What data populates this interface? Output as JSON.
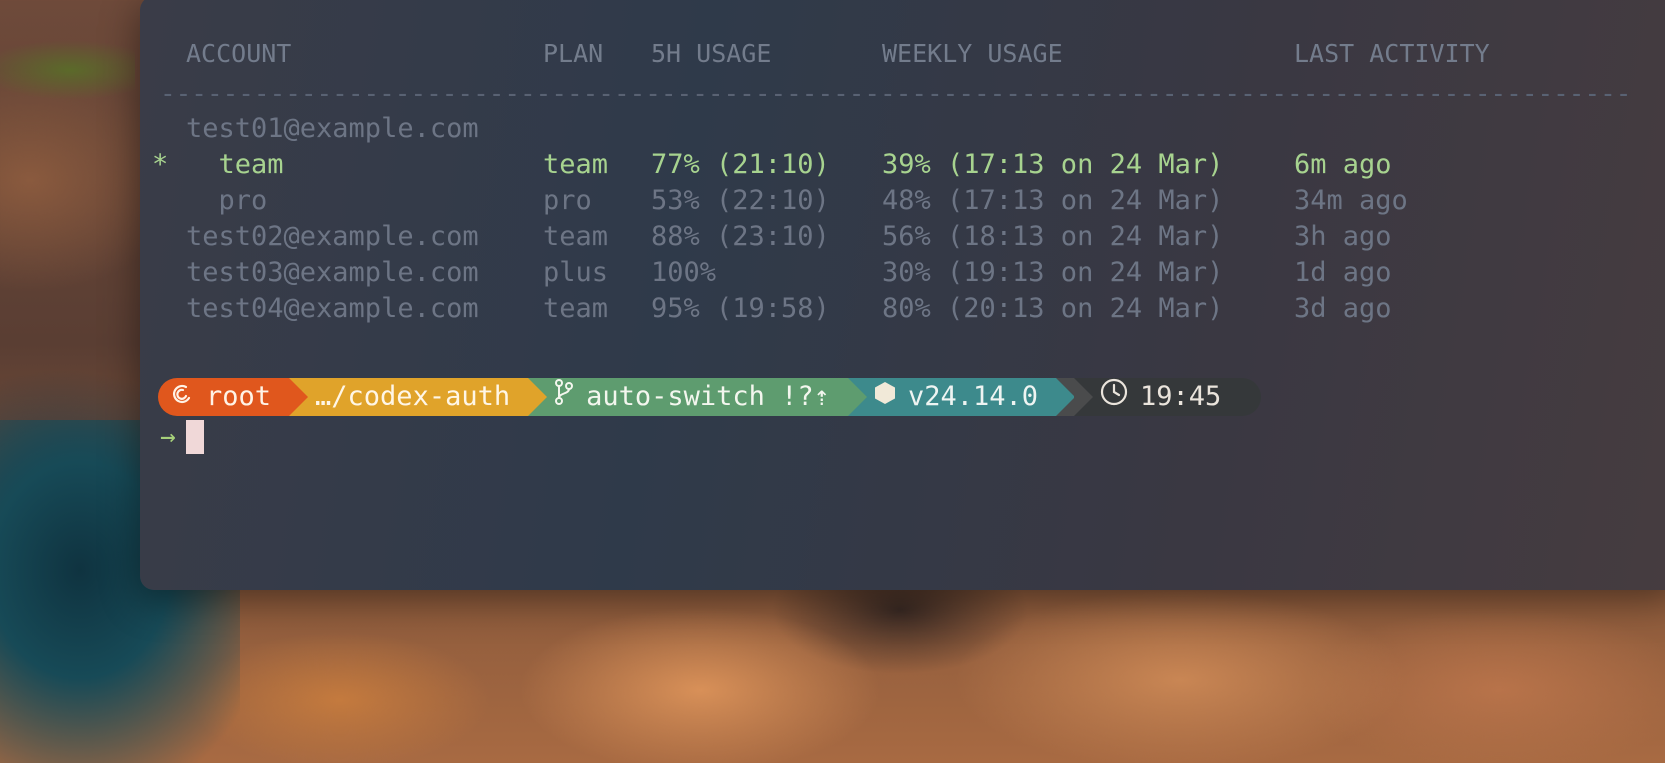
{
  "table": {
    "headers": {
      "account": "ACCOUNT",
      "plan": "PLAN",
      "five_hour": "5H USAGE",
      "weekly": "WEEKLY USAGE",
      "last_activity": "LAST ACTIVITY"
    },
    "divider": "------------------------------------------------------------------------------------------------------------",
    "rows": [
      {
        "marker": "",
        "account": "test01@example.com",
        "plan": "",
        "five_hour": "",
        "weekly": "",
        "last_activity": ""
      },
      {
        "marker": "*",
        "account": "  team",
        "plan": "team",
        "five_hour": "77% (21:10)",
        "weekly": "39% (17:13 on 24 Mar)",
        "last_activity": "6m ago"
      },
      {
        "marker": "",
        "account": "  pro",
        "plan": "pro",
        "five_hour": "53% (22:10)",
        "weekly": "48% (17:13 on 24 Mar)",
        "last_activity": "34m ago"
      },
      {
        "marker": "",
        "account": "test02@example.com",
        "plan": "team",
        "five_hour": "88% (23:10)",
        "weekly": "56% (18:13 on 24 Mar)",
        "last_activity": "3h ago"
      },
      {
        "marker": "",
        "account": "test03@example.com",
        "plan": "plus",
        "five_hour": "100%",
        "weekly": "30% (19:13 on 24 Mar)",
        "last_activity": "1d ago"
      },
      {
        "marker": "",
        "account": "test04@example.com",
        "plan": "team",
        "five_hour": "95% (19:58)",
        "weekly": "80% (20:13 on 24 Mar)",
        "last_activity": "3d ago"
      }
    ]
  },
  "prompt": {
    "user": "root",
    "path": "…/codex-auth",
    "git_branch": "auto-switch !?⇡",
    "node_version": "v24.14.0",
    "time": "19:45",
    "prompt_symbol": "→",
    "icons": [
      "debian-swirl-icon",
      "git-branch-icon",
      "node-hexagon-icon",
      "clock-icon"
    ]
  },
  "colors": {
    "active_row": "#a7d38f",
    "seg_user": "#e0571d",
    "seg_path": "#e0a32a",
    "seg_git": "#5e9c6f",
    "seg_node": "#3d8a8c",
    "seg_time": "#35383a"
  }
}
